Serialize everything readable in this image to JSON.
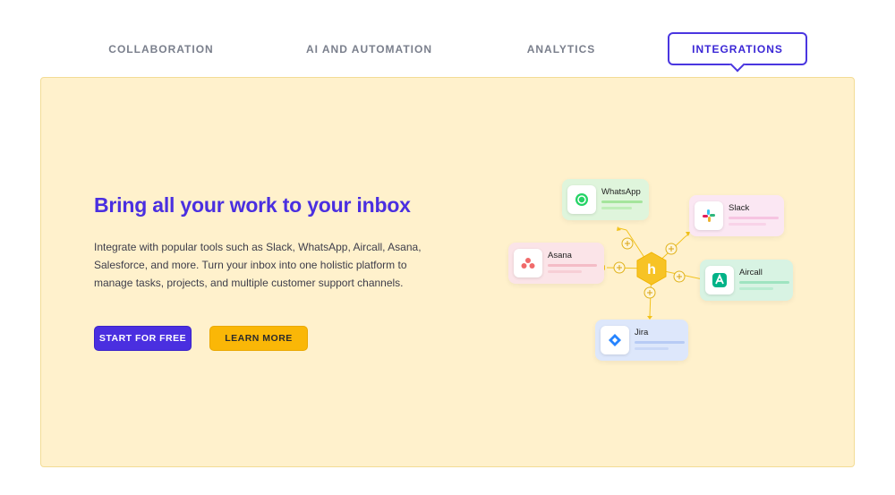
{
  "tabs": [
    {
      "label": "COLLABORATION",
      "active": false
    },
    {
      "label": "AI AND AUTOMATION",
      "active": false
    },
    {
      "label": "ANALYTICS",
      "active": false
    },
    {
      "label": "INTEGRATIONS",
      "active": true
    }
  ],
  "hero": {
    "headline": "Bring all your work to your inbox",
    "description": "Integrate with popular tools such as Slack, WhatsApp, Aircall, Asana, Salesforce, and more. Turn your inbox into one holistic platform to manage tasks, projects, and multiple customer support channels.",
    "primary_button": "START FOR FREE",
    "secondary_button": "LEARN MORE"
  },
  "integrations": [
    {
      "name": "WhatsApp",
      "icon": "whatsapp-icon"
    },
    {
      "name": "Slack",
      "icon": "slack-icon"
    },
    {
      "name": "Asana",
      "icon": "asana-icon"
    },
    {
      "name": "Aircall",
      "icon": "aircall-icon"
    },
    {
      "name": "Jira",
      "icon": "jira-icon"
    }
  ],
  "hub_logo": "h",
  "colors": {
    "accent": "#4a2fe0",
    "cta_secondary": "#fab707",
    "panel_bg": "#fff1cc"
  }
}
